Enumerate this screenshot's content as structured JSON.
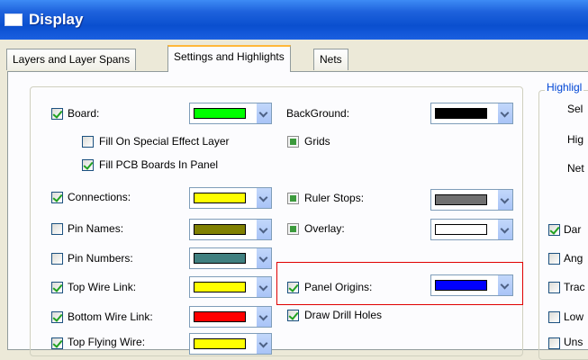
{
  "window": {
    "title": "Display"
  },
  "tabs": [
    {
      "label": "Layers and Layer Spans",
      "active": false
    },
    {
      "label": "Settings and Highlights",
      "active": true
    },
    {
      "label": "Nets",
      "active": false
    }
  ],
  "left_items": [
    {
      "label": "Board:",
      "checked": true,
      "color": "#00ff00",
      "has_combo": true
    },
    {
      "label": "Fill On Special Effect Layer",
      "checked": false,
      "has_combo": false
    },
    {
      "label": "Fill PCB Boards In Panel",
      "checked": true,
      "has_combo": false
    },
    {
      "label": "Connections:",
      "checked": true,
      "color": "#ffff00",
      "has_combo": true
    },
    {
      "label": "Pin Names:",
      "checked": false,
      "color": "#808000",
      "has_combo": true
    },
    {
      "label": "Pin Numbers:",
      "checked": false,
      "color": "#408080",
      "has_combo": true
    },
    {
      "label": "Top Wire Link:",
      "checked": true,
      "color": "#ffff00",
      "has_combo": true
    },
    {
      "label": "Bottom Wire Link:",
      "checked": true,
      "color": "#ff0000",
      "has_combo": true
    },
    {
      "label": "Top Flying Wire:",
      "checked": true,
      "color": "#ffff00",
      "has_combo": true
    }
  ],
  "mid_items": [
    {
      "label": "BackGround:",
      "checkbox": false,
      "color": "#000000",
      "has_combo": true
    },
    {
      "label": "Grids",
      "checkbox": "gray",
      "has_combo": false
    },
    {
      "label": "Ruler Stops:",
      "checkbox": "gray",
      "color": "#707070",
      "has_combo": true
    },
    {
      "label": "Overlay:",
      "checkbox": "gray",
      "color": "#ffffff",
      "has_combo": true
    },
    {
      "label": "Panel Origins:",
      "checkbox": "checked",
      "color": "#0000ff",
      "has_combo": true
    },
    {
      "label": "Draw Drill Holes",
      "checkbox": "checked",
      "has_combo": false
    }
  ],
  "right_group": {
    "legend": "Highligl",
    "labels": [
      "Sel",
      "Hig",
      "Net"
    ],
    "options": [
      {
        "label": "Dar",
        "checked": true
      },
      {
        "label": "Ang",
        "checked": false
      },
      {
        "label": "Trac",
        "checked": false
      },
      {
        "label": "Low",
        "checked": false
      },
      {
        "label": "Uns",
        "checked": false
      }
    ]
  }
}
